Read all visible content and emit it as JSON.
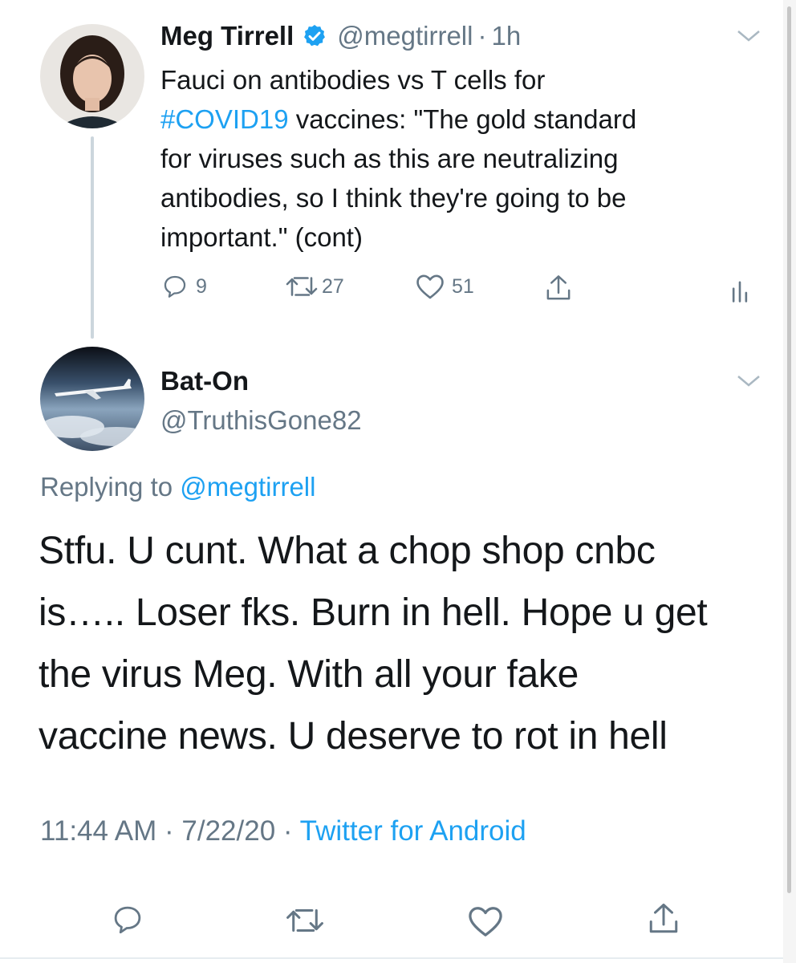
{
  "colors": {
    "accent": "#1da1f2",
    "muted": "#657786",
    "text": "#14171a",
    "thread": "#ccd6dd"
  },
  "tweet": {
    "author_name": "Meg Tirrell",
    "handle": "@megtirrell",
    "sep": "·",
    "time": "1h",
    "text_before_tag": "Fauci on antibodies vs T cells for",
    "hashtag": "#COVID19",
    "text_line2_rest": " vaccines: \"The gold standard",
    "text_line3": "for viruses such as this are neutralizing",
    "text_line4": "antibodies, so I think they're going to be",
    "text_line5": "important.\" (cont)",
    "replies": "9",
    "retweets": "27",
    "likes": "51",
    "verified_icon": "verified-badge-icon"
  },
  "reply": {
    "author_name": "Bat-On",
    "handle": "@TruthisGone82",
    "replying_prefix": "Replying to ",
    "replying_handle": "@megtirrell",
    "line1": "Stfu. U cunt. What a chop shop cnbc",
    "line2": "is….. Loser fks. Burn in hell. Hope u get",
    "line3": "the virus Meg. With all your fake",
    "line4": "vaccine news. U deserve to rot in hell",
    "time": "11:44 AM",
    "sep1": "·",
    "date": "7/22/20",
    "sep2": "·",
    "source": "Twitter for Android"
  }
}
